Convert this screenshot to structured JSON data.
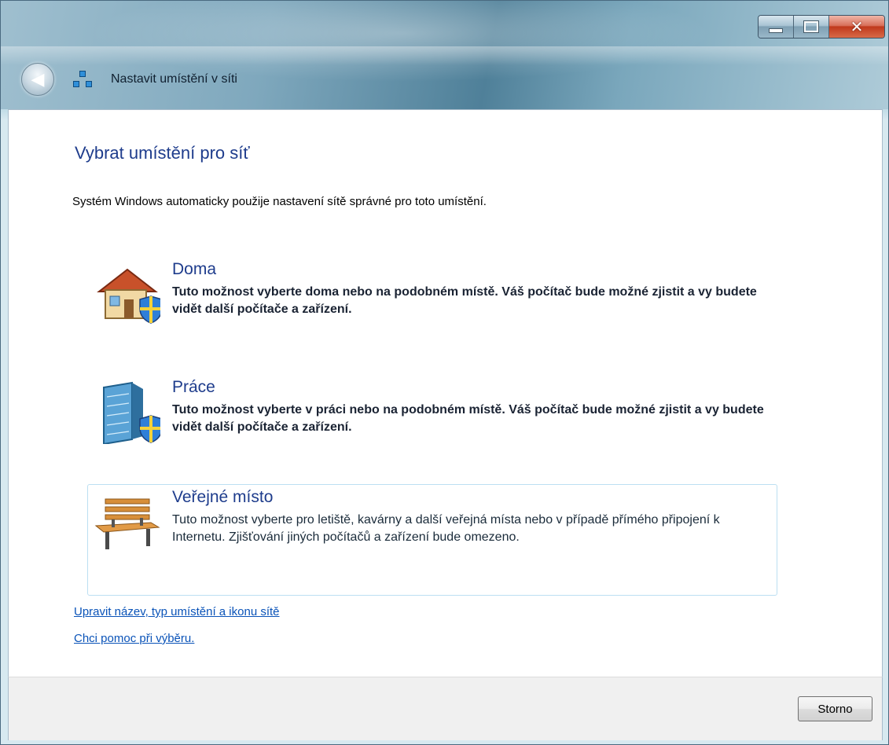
{
  "window": {
    "nav_title": "Nastavit umístění v síti"
  },
  "main": {
    "heading": "Vybrat umístění pro síť",
    "intro": "Systém Windows automaticky použije nastavení sítě správné pro toto umístění.",
    "options": [
      {
        "title": "Doma",
        "description": "Tuto možnost vyberte doma nebo na podobném místě. Váš počítač bude možné zjistit a vy budete vidět další počítače a zařízení.",
        "icon": "home-icon"
      },
      {
        "title": "Práce",
        "description": "Tuto možnost vyberte v práci nebo na podobném místě. Váš počítač bude možné zjistit a vy budete vidět další počítače a zařízení.",
        "icon": "office-building-icon"
      },
      {
        "title": "Veřejné místo",
        "description": "Tuto možnost vyberte pro letiště, kavárny a další veřejná místa nebo v případě přímého připojení k Internetu. Zjišťování jiných počítačů a zařízení bude omezeno.",
        "icon": "park-bench-icon"
      }
    ],
    "links": {
      "customize": "Upravit název, typ umístění a ikonu sítě",
      "help": "Chci pomoc při výběru."
    }
  },
  "footer": {
    "cancel_label": "Storno"
  },
  "colors": {
    "heading": "#1e3c8c",
    "link": "#0a53b8",
    "selection_border": "#bcdff2"
  }
}
